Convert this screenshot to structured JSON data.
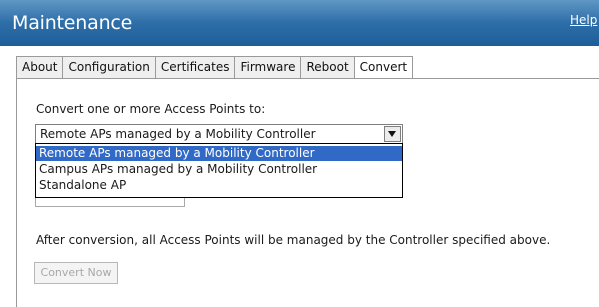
{
  "header": {
    "title": "Maintenance",
    "help_label": "Help"
  },
  "tabs": [
    {
      "label": "About",
      "active": false
    },
    {
      "label": "Configuration",
      "active": false
    },
    {
      "label": "Certificates",
      "active": false
    },
    {
      "label": "Firmware",
      "active": false
    },
    {
      "label": "Reboot",
      "active": false
    },
    {
      "label": "Convert",
      "active": true
    }
  ],
  "convert": {
    "prompt": "Convert one or more Access Points to:",
    "selected": "Remote APs managed by a Mobility Controller",
    "options": [
      "Remote APs managed by a Mobility Controller",
      "Campus APs managed by a Mobility Controller",
      "Standalone AP"
    ],
    "highlighted_option": "Remote APs managed by a Mobility Controller",
    "info": "After conversion, all Access Points will be managed by the Controller specified above.",
    "button_label": "Convert Now",
    "button_enabled": false
  },
  "colors": {
    "header_top": "#5f97c4",
    "header_bottom": "#1d5d99",
    "selection": "#3169c6"
  },
  "icons": {
    "dropdown": "chevron-down-icon"
  }
}
